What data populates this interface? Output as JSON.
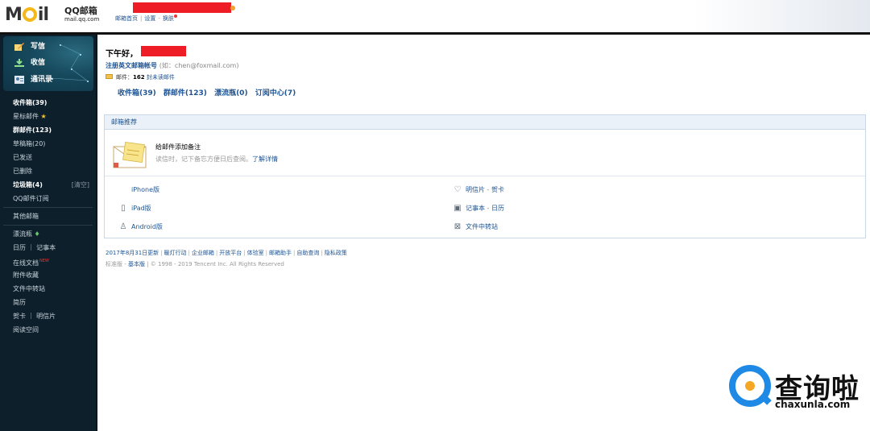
{
  "header": {
    "logo_text": "M",
    "logo_text2": "il",
    "product_name": "QQ邮箱",
    "product_url": "mail.qq.com",
    "links": [
      "邮箱首页",
      "设置",
      "换肤"
    ]
  },
  "sidebar": {
    "actions": [
      {
        "label": "写信",
        "icon": "pencil-paper-icon"
      },
      {
        "label": "收信",
        "icon": "download-icon"
      },
      {
        "label": "通讯录",
        "icon": "contacts-icon"
      }
    ],
    "folders": [
      {
        "label": "收件箱(39)",
        "bold": true
      },
      {
        "label": "星标邮件",
        "icon": "star-icon"
      },
      {
        "label": "群邮件(123)",
        "bold": true
      },
      {
        "label": "草稿箱(20)"
      },
      {
        "label": "已发送"
      },
      {
        "label": "已删除"
      },
      {
        "label": "垃圾箱(4)",
        "bold": true,
        "action": "[清空]"
      },
      {
        "label": "QQ邮件订阅"
      }
    ],
    "other_label": "其他邮箱",
    "tools": [
      {
        "label": "漂流瓶",
        "icon": "bottle-icon"
      },
      {
        "label": "日历 ｜ 记事本"
      },
      {
        "label": "在线文档",
        "badge": "NEW"
      },
      {
        "label": "附件收藏"
      },
      {
        "label": "文件中转站"
      },
      {
        "label": "简历"
      },
      {
        "label": "贺卡 ｜ 明信片"
      },
      {
        "label": "阅读空间"
      }
    ]
  },
  "main": {
    "greeting": "下午好，",
    "register": "注册英文邮箱帐号",
    "register_hint": "(如：chen@foxmail.com)",
    "mail_count_prefix": "邮件：",
    "mail_count": "162",
    "mail_count_suffix": "封未读邮件",
    "quick_links": [
      "收件箱(39)",
      "群邮件(123)",
      "漂流瓶(0)",
      "订阅中心(7)"
    ],
    "recommend": {
      "title": "邮箱推荐",
      "tip_title": "给邮件添加备注",
      "tip_desc": "读信时，记下备忘方便日后查阅。",
      "tip_link": "了解详情",
      "apps_left": [
        "iPhone版",
        "iPad版",
        "Android版"
      ],
      "apps_right": [
        {
          "a": "明信片",
          "b": "贺卡"
        },
        {
          "a": "记事本",
          "b": "日历"
        },
        {
          "a": "文件中转站",
          "b": ""
        }
      ]
    },
    "footer_links": [
      "2017年8月31日更新",
      "暖灯行动",
      "企业邮箱",
      "开放平台",
      "体验室",
      "邮箱助手",
      "自助查询",
      "隐私政策"
    ],
    "footer_std": "标准版",
    "footer_basic": "基本版",
    "copyright": "© 1998 - 2019 Tencent Inc. All Rights Reserved"
  },
  "watermark": {
    "cn": "查询啦",
    "en": "chaxunla.com"
  }
}
